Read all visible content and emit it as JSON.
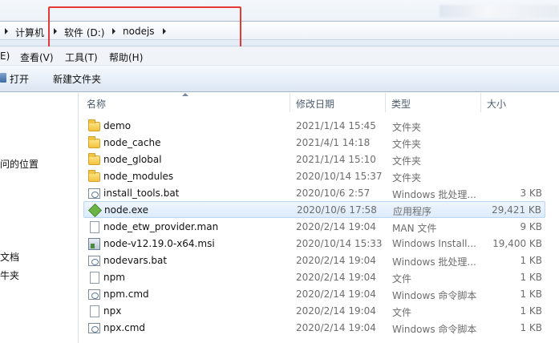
{
  "address": {
    "crumbs": [
      "计算机",
      "软件 (D:)",
      "nodejs"
    ]
  },
  "menu": {
    "items": [
      "E)",
      "查看(V)",
      "工具(T)",
      "帮助(H)"
    ]
  },
  "toolbar": {
    "open_label": "打开",
    "new_folder_label": "新建文件夹"
  },
  "nav": {
    "items": [
      "问的位置",
      "文档",
      "牛夹"
    ]
  },
  "columns": {
    "name": "名称",
    "date": "修改日期",
    "type": "类型",
    "size": "大小"
  },
  "files": [
    {
      "name": "demo",
      "date": "2021/1/14 15:45",
      "type": "文件夹",
      "size": "",
      "icon": "folder-icon"
    },
    {
      "name": "node_cache",
      "date": "2021/4/1 14:18",
      "type": "文件夹",
      "size": "",
      "icon": "folder-icon"
    },
    {
      "name": "node_global",
      "date": "2021/1/14 15:10",
      "type": "文件夹",
      "size": "",
      "icon": "folder-icon"
    },
    {
      "name": "node_modules",
      "date": "2020/10/14 15:37",
      "type": "文件夹",
      "size": "",
      "icon": "folder-icon"
    },
    {
      "name": "install_tools.bat",
      "date": "2020/10/6 2:57",
      "type": "Windows 批处理...",
      "size": "3 KB",
      "icon": "batch-file-icon"
    },
    {
      "name": "node.exe",
      "date": "2020/10/6 17:58",
      "type": "应用程序",
      "size": "29,421 KB",
      "icon": "node-exe-icon",
      "selected": true
    },
    {
      "name": "node_etw_provider.man",
      "date": "2020/2/14 19:04",
      "type": "MAN 文件",
      "size": "9 KB",
      "icon": "document-icon"
    },
    {
      "name": "node-v12.19.0-x64.msi",
      "date": "2020/10/14 15:33",
      "type": "Windows Install...",
      "size": "19,400 KB",
      "icon": "installer-icon"
    },
    {
      "name": "nodevars.bat",
      "date": "2020/2/14 19:04",
      "type": "Windows 批处理...",
      "size": "1 KB",
      "icon": "batch-file-icon"
    },
    {
      "name": "npm",
      "date": "2020/2/14 19:04",
      "type": "文件",
      "size": "1 KB",
      "icon": "document-icon"
    },
    {
      "name": "npm.cmd",
      "date": "2020/2/14 19:04",
      "type": "Windows 命令脚本",
      "size": "1 KB",
      "icon": "cmd-script-icon"
    },
    {
      "name": "npx",
      "date": "2020/2/14 19:04",
      "type": "文件",
      "size": "1 KB",
      "icon": "document-icon"
    },
    {
      "name": "npx.cmd",
      "date": "2020/2/14 19:04",
      "type": "Windows 命令脚本",
      "size": "1 KB",
      "icon": "cmd-script-icon"
    }
  ],
  "colors": {
    "highlight_box": "#e53935",
    "selected_row": "#dcebfb"
  }
}
